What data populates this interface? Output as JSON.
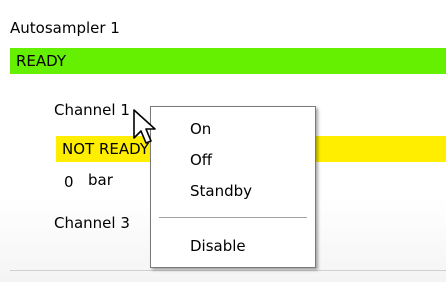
{
  "autosampler": {
    "title": "Autosampler 1",
    "status": "READY",
    "status_color": "#64f000"
  },
  "channel1": {
    "label": "Channel 1",
    "status": "NOT READY",
    "status_color": "#ffee00",
    "reading_value": "0",
    "reading_unit": "bar"
  },
  "channel3": {
    "label": "Channel 3"
  },
  "context_menu": {
    "items": [
      {
        "label": "On"
      },
      {
        "label": "Off"
      },
      {
        "label": "Standby"
      },
      {
        "label": "Disable"
      }
    ]
  },
  "cursor": {
    "icon": "arrow-pointer-icon"
  }
}
